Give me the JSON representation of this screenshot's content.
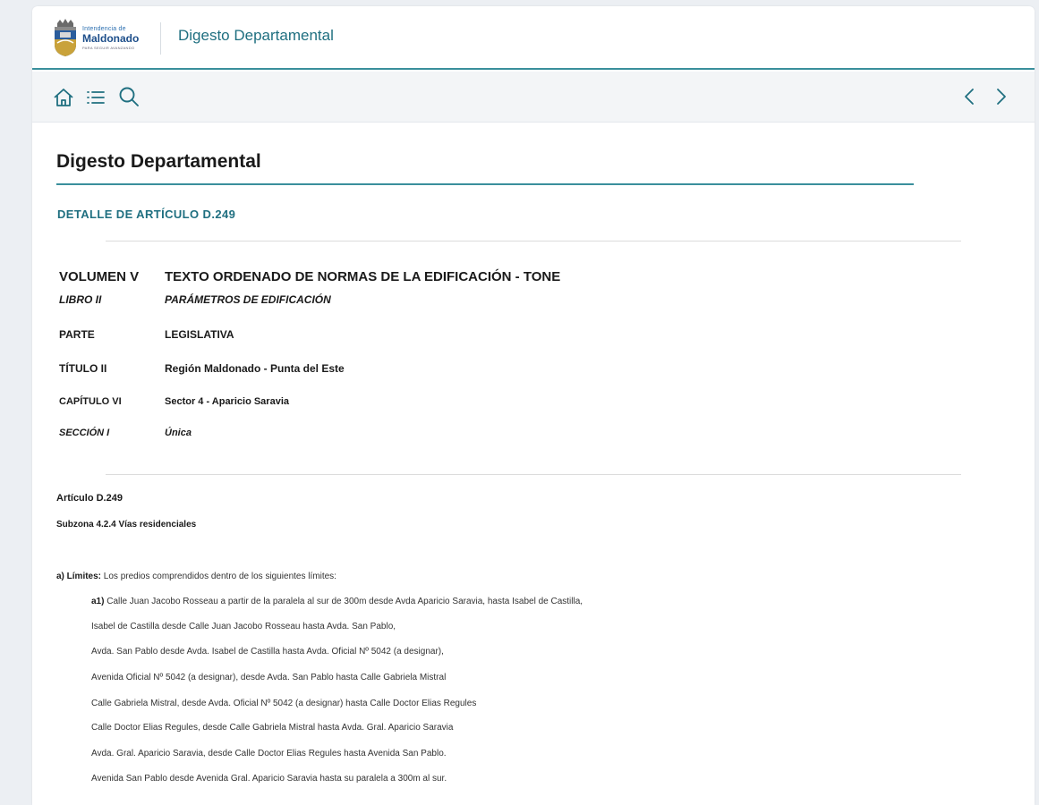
{
  "header": {
    "logo": {
      "line1": "Intendencia de",
      "line2": "Maldonado",
      "tagline": "PARA SEGUIR AVANZANDO"
    },
    "title": "Digesto Departamental"
  },
  "toolbar": {
    "left_icons": [
      "home-icon",
      "list-icon",
      "search-icon"
    ],
    "right_icons": [
      "chevron-left-icon",
      "chevron-right-icon"
    ]
  },
  "colors": {
    "accent": "#3a8f9c",
    "accent_text": "#1f6f80"
  },
  "page": {
    "title": "Digesto Departamental",
    "detail_heading": "DETALLE DE ARTÍCULO D.249"
  },
  "meta": {
    "volumen": {
      "key": "VOLUMEN V",
      "value": "TEXTO ORDENADO DE NORMAS DE LA EDIFICACIÓN - TONE"
    },
    "libro": {
      "key": "LIBRO II",
      "value": "PARÁMETROS DE EDIFICACIÓN"
    },
    "parte": {
      "key": "PARTE",
      "value": "LEGISLATIVA"
    },
    "titulo": {
      "key": "TÍTULO II",
      "value": "Región Maldonado - Punta del Este"
    },
    "capitulo": {
      "key": "CAPÍTULO VI",
      "value": "Sector 4 - Aparicio Saravia"
    },
    "seccion": {
      "key": "SECCIÓN I",
      "value": "Única"
    }
  },
  "article": {
    "number": "Artículo D.249",
    "subzone": "Subzona 4.2.4 Vías residenciales",
    "limits_label": "a) Límites:",
    "limits_intro": " Los predios comprendidos dentro de los siguientes límites:",
    "a1_label": "a1)",
    "a1_text": " Calle Juan Jacobo Rosseau a partir de la paralela al sur de 300m desde Avda Aparicio Saravia, hasta Isabel de Castilla,",
    "lines": [
      "Isabel de Castilla desde Calle Juan Jacobo Rosseau hasta Avda. San Pablo,",
      "Avda. San Pablo desde Avda. Isabel de Castilla hasta Avda. Oficial Nº 5042 (a designar),",
      "Avenida Oficial Nº 5042 (a designar), desde Avda. San Pablo hasta Calle Gabriela Mistral",
      "Calle Gabriela Mistral, desde Avda. Oficial Nº 5042 (a designar) hasta Calle Doctor Elias Regules",
      "Calle Doctor Elias Regules, desde Calle Gabriela Mistral hasta Avda. Gral. Aparicio Saravia",
      "Avda. Gral. Aparicio Saravia, desde Calle Doctor Elias Regules hasta Avenida San Pablo.",
      "Avenida San Pablo desde Avenida Gral. Aparicio Saravia hasta su paralela a 300m al sur."
    ]
  }
}
